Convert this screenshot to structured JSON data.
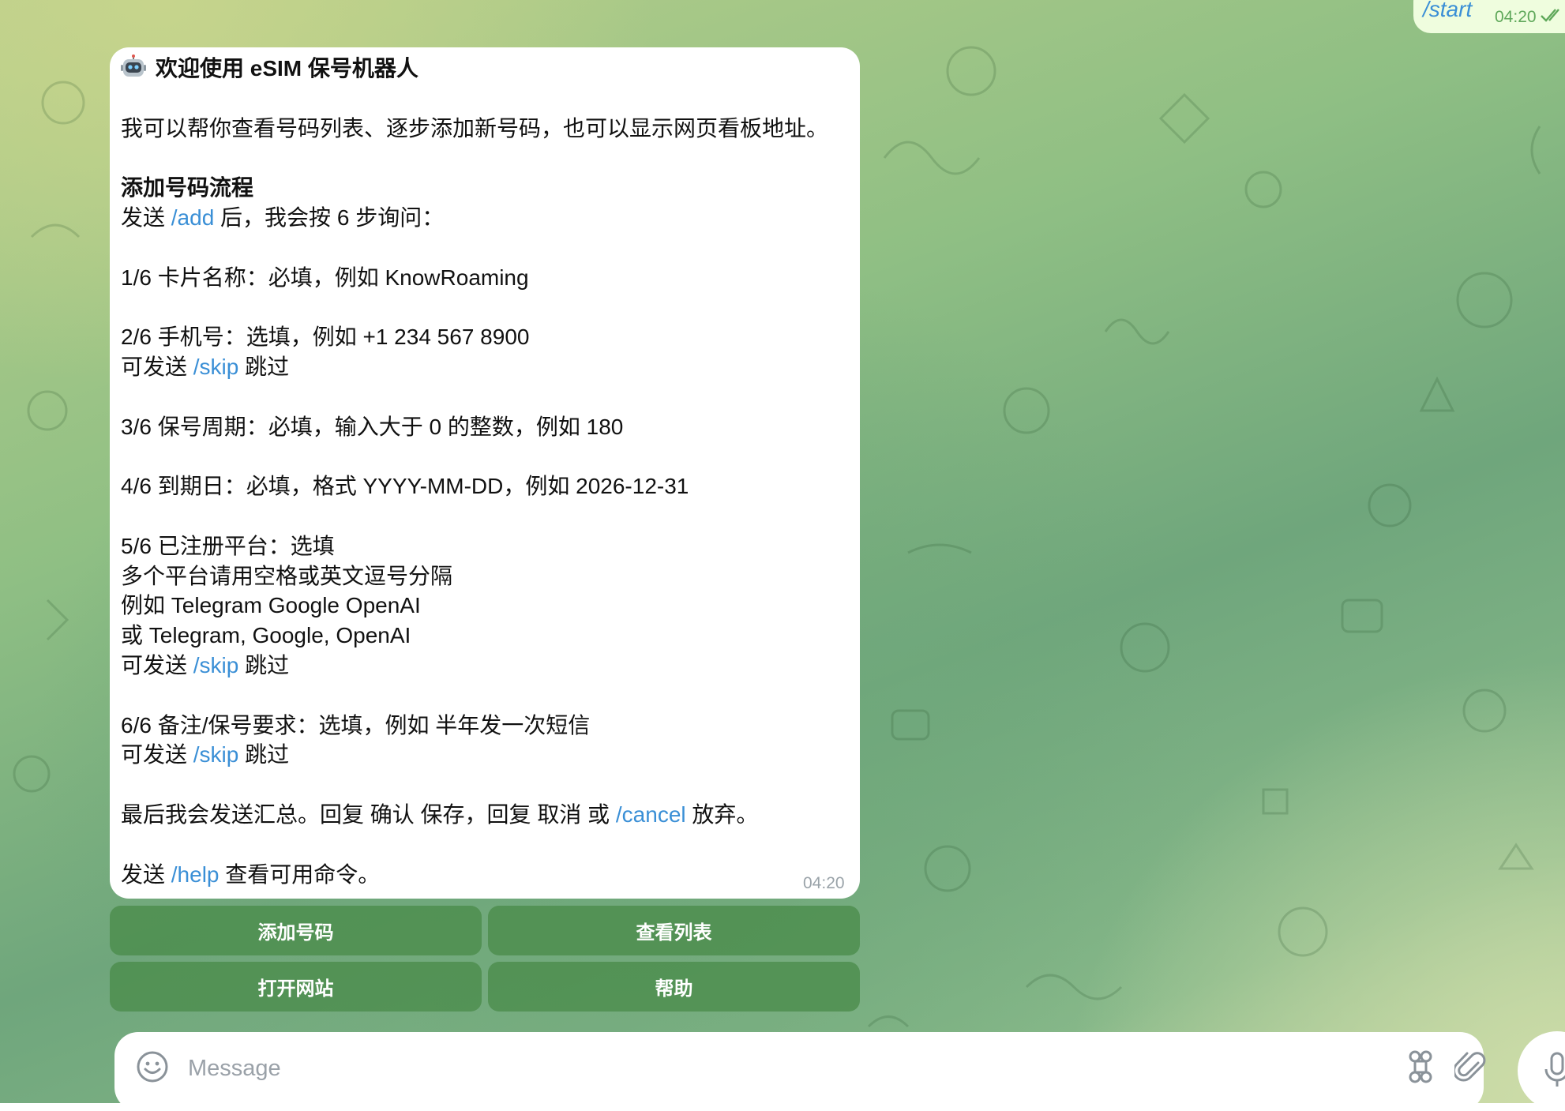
{
  "outgoing": {
    "text": "/start",
    "time": "04:20",
    "status_icon": "double-check-icon"
  },
  "incoming": {
    "icon": "robot-emoji-icon",
    "time": "04:20",
    "lines": [
      {
        "style": "title",
        "parts": [
          {
            "t": "欢迎使用 eSIM 保号机器人"
          }
        ]
      },
      {
        "parts": []
      },
      {
        "parts": [
          {
            "t": "我可以帮你查看号码列表、逐步添加新号码，也可以显示网页看板地址。"
          }
        ]
      },
      {
        "parts": []
      },
      {
        "style": "bold",
        "parts": [
          {
            "t": "添加号码流程"
          }
        ]
      },
      {
        "parts": [
          {
            "t": "发送 "
          },
          {
            "t": "/add",
            "cmd": true
          },
          {
            "t": " 后，我会按 6 步询问："
          }
        ]
      },
      {
        "parts": []
      },
      {
        "parts": [
          {
            "t": "1/6 卡片名称：必填，例如 KnowRoaming"
          }
        ]
      },
      {
        "parts": []
      },
      {
        "parts": [
          {
            "t": "2/6 手机号：选填，例如 +1 234 567 8900"
          }
        ]
      },
      {
        "parts": [
          {
            "t": "可发送 "
          },
          {
            "t": "/skip",
            "cmd": true
          },
          {
            "t": " 跳过"
          }
        ]
      },
      {
        "parts": []
      },
      {
        "parts": [
          {
            "t": "3/6 保号周期：必填，输入大于 0 的整数，例如 180"
          }
        ]
      },
      {
        "parts": []
      },
      {
        "parts": [
          {
            "t": "4/6 到期日：必填，格式 YYYY-MM-DD，例如 2026-12-31"
          }
        ]
      },
      {
        "parts": []
      },
      {
        "parts": [
          {
            "t": "5/6 已注册平台：选填"
          }
        ]
      },
      {
        "parts": [
          {
            "t": "多个平台请用空格或英文逗号分隔"
          }
        ]
      },
      {
        "parts": [
          {
            "t": "例如 Telegram Google OpenAI"
          }
        ]
      },
      {
        "parts": [
          {
            "t": "或 Telegram, Google, OpenAI"
          }
        ]
      },
      {
        "parts": [
          {
            "t": "可发送 "
          },
          {
            "t": "/skip",
            "cmd": true
          },
          {
            "t": " 跳过"
          }
        ]
      },
      {
        "parts": []
      },
      {
        "parts": [
          {
            "t": "6/6 备注/保号要求：选填，例如 半年发一次短信"
          }
        ]
      },
      {
        "parts": [
          {
            "t": "可发送 "
          },
          {
            "t": "/skip",
            "cmd": true
          },
          {
            "t": " 跳过"
          }
        ]
      },
      {
        "parts": []
      },
      {
        "parts": [
          {
            "t": "最后我会发送汇总。回复 确认 保存，回复 取消 或 "
          },
          {
            "t": "/cancel",
            "cmd": true
          },
          {
            "t": " 放弃。"
          }
        ]
      },
      {
        "parts": []
      },
      {
        "parts": [
          {
            "t": "发送 "
          },
          {
            "t": "/help",
            "cmd": true
          },
          {
            "t": " 查看可用命令。"
          }
        ]
      }
    ]
  },
  "keyboard": {
    "add_number": "添加号码",
    "view_list": "查看列表",
    "open_site": "打开网站",
    "help": "帮助"
  },
  "composer": {
    "placeholder": "Message",
    "emoji_icon": "emoji-smile-icon",
    "command_icon": "command-icon",
    "attach_icon": "paperclip-icon",
    "mic_icon": "microphone-icon"
  },
  "colors": {
    "command_link": "#3a8fd6",
    "keyboard_button": "#4a8c4a",
    "outgoing_bubble": "#effdde"
  }
}
